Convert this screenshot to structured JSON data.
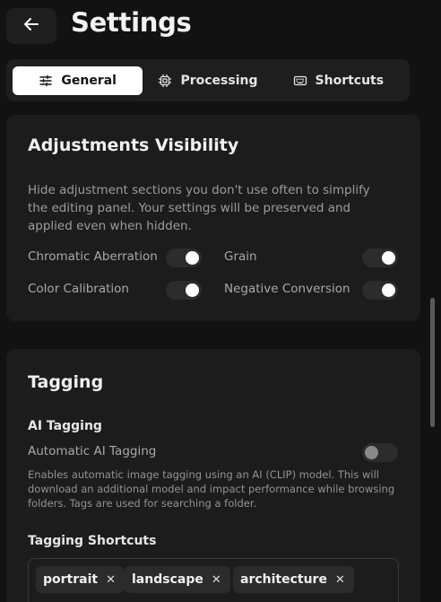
{
  "header": {
    "title": "Settings",
    "back_icon": "arrow-left-icon"
  },
  "tabs": [
    {
      "label": "General",
      "icon": "sliders-icon",
      "active": true
    },
    {
      "label": "Processing",
      "icon": "cpu-icon",
      "active": false
    },
    {
      "label": "Shortcuts",
      "icon": "keyboard-icon",
      "active": false
    }
  ],
  "adjustments": {
    "title": "Adjustments Visibility",
    "description": "Hide adjustment sections you don't use often to simplify the editing panel. Your settings will be preserved and applied even when hidden.",
    "options": [
      {
        "label": "Chromatic Aberration",
        "on": true
      },
      {
        "label": "Grain",
        "on": true
      },
      {
        "label": "Color Calibration",
        "on": true
      },
      {
        "label": "Negative Conversion",
        "on": true
      }
    ]
  },
  "tagging": {
    "title": "Tagging",
    "ai_heading": "AI Tagging",
    "auto_label": "Automatic AI Tagging",
    "auto_on": false,
    "auto_description": "Enables automatic image tagging using an AI (CLIP) model. This will download an additional model and impact performance while browsing folders. Tags are used for searching a folder.",
    "shortcuts_heading": "Tagging Shortcuts",
    "chips": [
      "portrait",
      "landscape",
      "architecture"
    ]
  },
  "colors": {
    "background": "#121212",
    "card": "#1c1c1c",
    "accent": "#ffffff"
  }
}
